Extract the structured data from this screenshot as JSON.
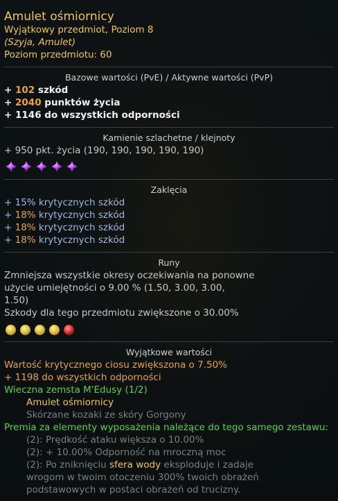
{
  "item": {
    "name": "Amulet ośmiornicy",
    "subtitle": "Wyjątkowy przedmiot, Poziom 8",
    "slot": "(Szyja, Amulet)",
    "item_level_label": "Poziom przedmiotu:",
    "item_level_value": "60"
  },
  "base": {
    "title": "Bazowe wartości (PvE) / Aktywne wartości (PvP)",
    "stats": [
      {
        "prefix": "+ ",
        "value": "102",
        "label": " szkód"
      },
      {
        "prefix": "+ ",
        "value": "2040",
        "label": " punktów życia"
      },
      {
        "prefix": "+ ",
        "value": "1146",
        "label": " do wszystkich odporności"
      }
    ]
  },
  "gems": {
    "title": "Kamienie szlachetne / klejnoty",
    "line": "+ 950 pkt. życia (190, 190, 190, 190, 190)",
    "icons": [
      "purple-gem-icon",
      "purple-gem-icon",
      "purple-gem-icon",
      "purple-gem-icon",
      "purple-gem-icon"
    ],
    "icon_color": "#a22ee0"
  },
  "enchant": {
    "title": "Zaklęcia",
    "lines": [
      {
        "prefix": "+ ",
        "value": "15%",
        "label": " krytycznych szkód",
        "value_color": "#9fb8e8"
      },
      {
        "prefix": "+ ",
        "value": "18%",
        "label": " krytycznych szkód",
        "value_color": "#e9a33c"
      },
      {
        "prefix": "+ ",
        "value": "18%",
        "label": " krytycznych szkód",
        "value_color": "#e9a33c"
      },
      {
        "prefix": "+ ",
        "value": "18%",
        "label": " krytycznych szkód",
        "value_color": "#e9a33c"
      }
    ]
  },
  "runes": {
    "title": "Runy",
    "line1": "Zmniejsza wszystkie okresy oczekiwania na ponowne",
    "line2": "użycie umiejętności o 9.00 % (1.50, 3.00, 3.00,",
    "line3": "1.50)",
    "line4": "Szkody dla tego przedmiotu zwiększone o 30.00%",
    "icons": [
      "gold-rune-icon",
      "gold-rune-icon",
      "gold-rune-icon",
      "gold-rune-icon",
      "red-rune-icon"
    ]
  },
  "unique": {
    "title": "Wyjątkowe wartości",
    "line1": "Wartość krytycznego ciosu zwiększona o 7.50%",
    "line2": "+ 1198 do wszystkich odporności",
    "set_name_line": "Wieczna zemsta M'Edusy (1/2)",
    "set_items": [
      "Amulet ośmiornicy",
      "Skórzane kozaki ze skóry Gorgony"
    ],
    "bonus_header": "Premia za elementy wyposażenia należące do tego samego zestawu:",
    "bonus1": "(2): Prędkość ataku większa o 10.00%",
    "bonus2": "(2): + 10.00% Odporność na mroczną moc",
    "bonus3_pre": "(2): Po zniknięciu ",
    "bonus3_highlight": "sfera wody",
    "bonus3_post": " eksploduje i zadaje",
    "bonus3_line2": "wrogom w twoim otoczeniu 300% twoich obrażeń",
    "bonus3_line3": "podstawowych w postaci obrażeń od trucizny."
  }
}
